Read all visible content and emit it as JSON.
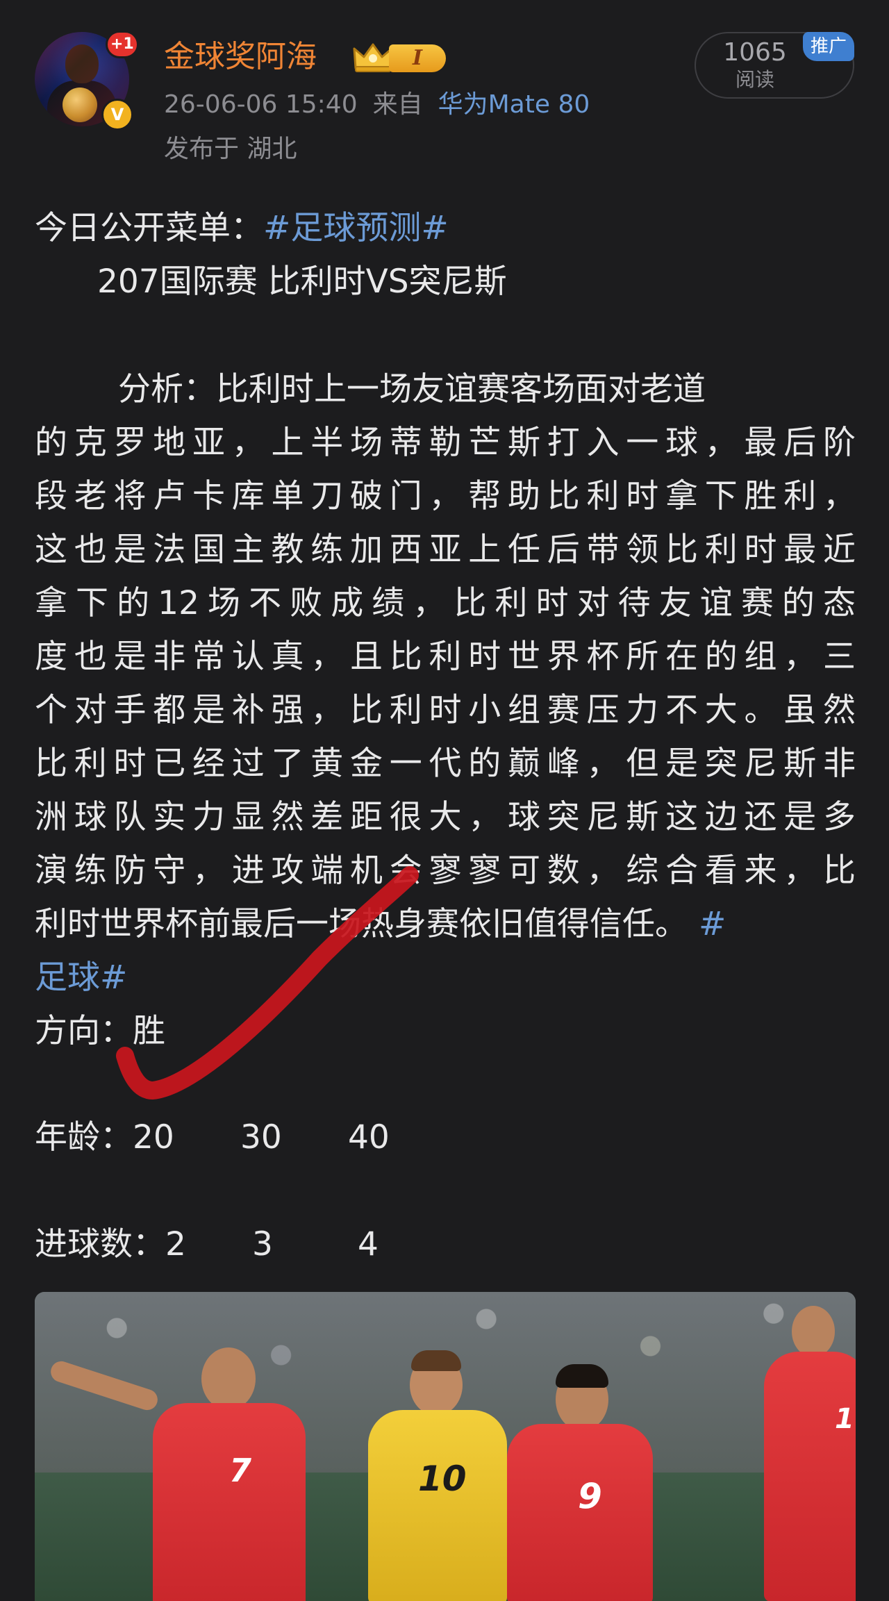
{
  "author": {
    "name": "金球奖阿海",
    "level": "I",
    "notification_badge": "+1",
    "verified_mark": "V",
    "post_time": "26-06-06 15:40",
    "source_prefix": "来自",
    "device": "华为Mate 80",
    "location": "发布于 湖北"
  },
  "stats": {
    "read_count": "1065",
    "read_label": "阅读",
    "promo_label": "推广"
  },
  "post": {
    "menu_prefix": "今日公开菜单：",
    "menu_hashtag": "#足球预测#",
    "match": "207国际赛  比利时VS突尼斯",
    "analysis_lines": [
      "分析：比利时上一场友谊赛客场面对老道",
      "的克罗地亚，上半场蒂勒芒斯打入一球，最后阶",
      "段老将卢卡库单刀破门，帮助比利时拿下胜利，",
      "这也是法国主教练加西亚上任后带领比利时最近",
      "拿下的12场不败成绩，比利时对待友谊赛的态",
      "度也是非常认真，且比利时世界杯所在的组，三",
      "个对手都是补强，比利时小组赛压力不大。虽然",
      "比利时已经过了黄金一代的巅峰，但是突尼斯非",
      "洲球队实力显然差距很大，球突尼斯这边还是多",
      "演练防守，进攻端机会寥寥可数，综合看来，比"
    ],
    "analysis_last_text": "利时世界杯前最后一场热身赛依旧值得信任。",
    "analysis_last_hashtag_start": "#",
    "footer_hashtag": "足球#",
    "direction_label": "方向：",
    "direction_value": "胜",
    "age_label": "年龄：",
    "age_values": [
      "20",
      "30",
      "40"
    ],
    "goals_label": "进球数：",
    "goals_values": [
      "2",
      "3",
      "4"
    ]
  },
  "photo": {
    "jersey_numbers": [
      "7",
      "10",
      "9",
      "1"
    ]
  },
  "colors": {
    "background": "#1c1c1e",
    "username": "#f08535",
    "hashtag": "#6c9bd6",
    "check_mark": "#c8161d"
  }
}
